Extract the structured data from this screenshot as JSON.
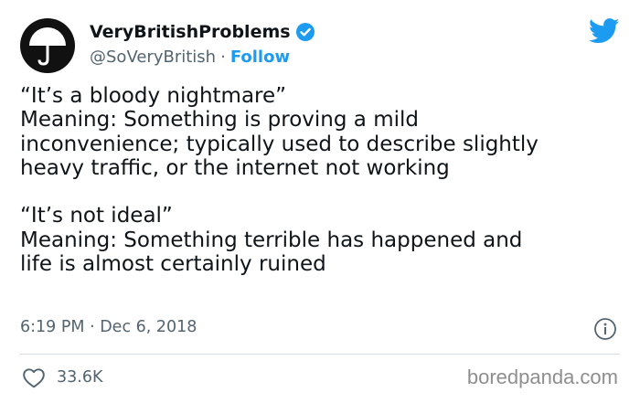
{
  "author": {
    "display_name": "VeryBritishProblems",
    "handle": "@SoVeryBritish",
    "separator": "·",
    "follow_label": "Follow",
    "verified": true
  },
  "tweet": {
    "lines": [
      "“It’s a bloody nightmare”",
      "Meaning: Something is proving a mild",
      "inconvenience; typically used to describe slightly",
      "heavy traffic, or the internet not working",
      "“It’s not ideal”",
      "Meaning: Something terrible has happened and",
      "life is almost certainly ruined"
    ],
    "timestamp": "6:19 PM · Dec 6, 2018"
  },
  "engagement": {
    "likes": "33.6K"
  },
  "watermark": "boredpanda.com",
  "colors": {
    "accent": "#1d9bf0",
    "text": "#0f1419",
    "muted": "#536471"
  },
  "icons": [
    "umbrella-avatar",
    "verified-badge-icon",
    "twitter-bird-icon",
    "info-icon",
    "heart-icon"
  ]
}
